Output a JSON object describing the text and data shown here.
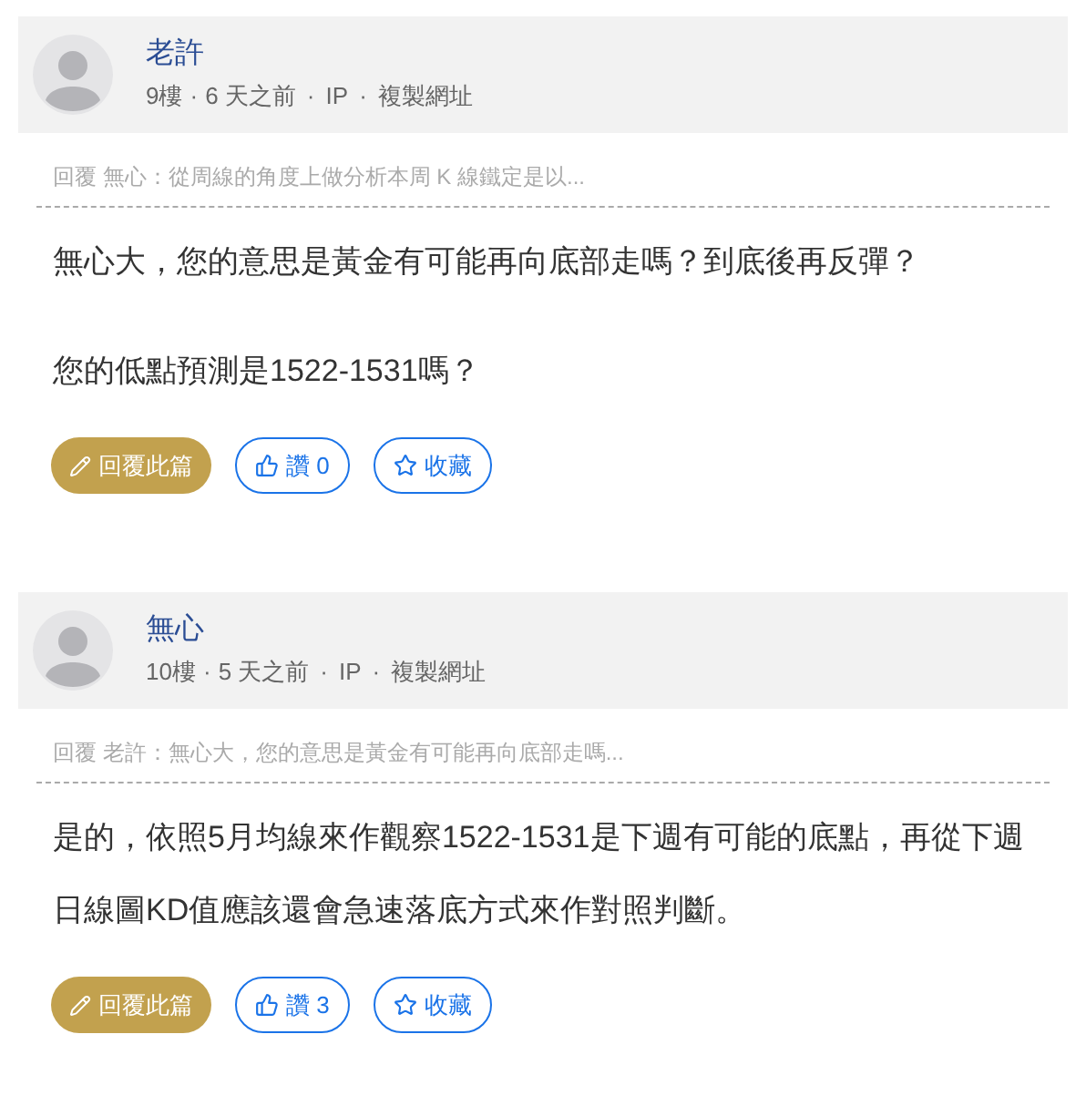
{
  "separator": "·",
  "posts": [
    {
      "author": "老許",
      "floor": "9樓",
      "time": "6 天之前",
      "ip": "IP",
      "copy_link": "複製網址",
      "quote": "回覆 無心：從周線的角度上做分析本周 K 線鐵定是以...",
      "paragraphs": [
        "無心大，您的意思是黃金有可能再向底部走嗎？到底後再反彈？",
        "您的低點預測是1522-1531嗎？"
      ],
      "reply_button": "回覆此篇",
      "like_button": "讚 0",
      "save_button": "收藏"
    },
    {
      "author": "無心",
      "floor": "10樓",
      "time": "5 天之前",
      "ip": "IP",
      "copy_link": "複製網址",
      "quote": "回覆 老許：無心大，您的意思是黃金有可能再向底部走嗎...",
      "paragraphs": [
        "是的，依照5月均線來作觀察1522-1531是下週有可能的底點，再從下週日線圖KD值應該還會急速落底方式來作對照判斷。"
      ],
      "reply_button": "回覆此篇",
      "like_button": "讚 3",
      "save_button": "收藏"
    }
  ]
}
